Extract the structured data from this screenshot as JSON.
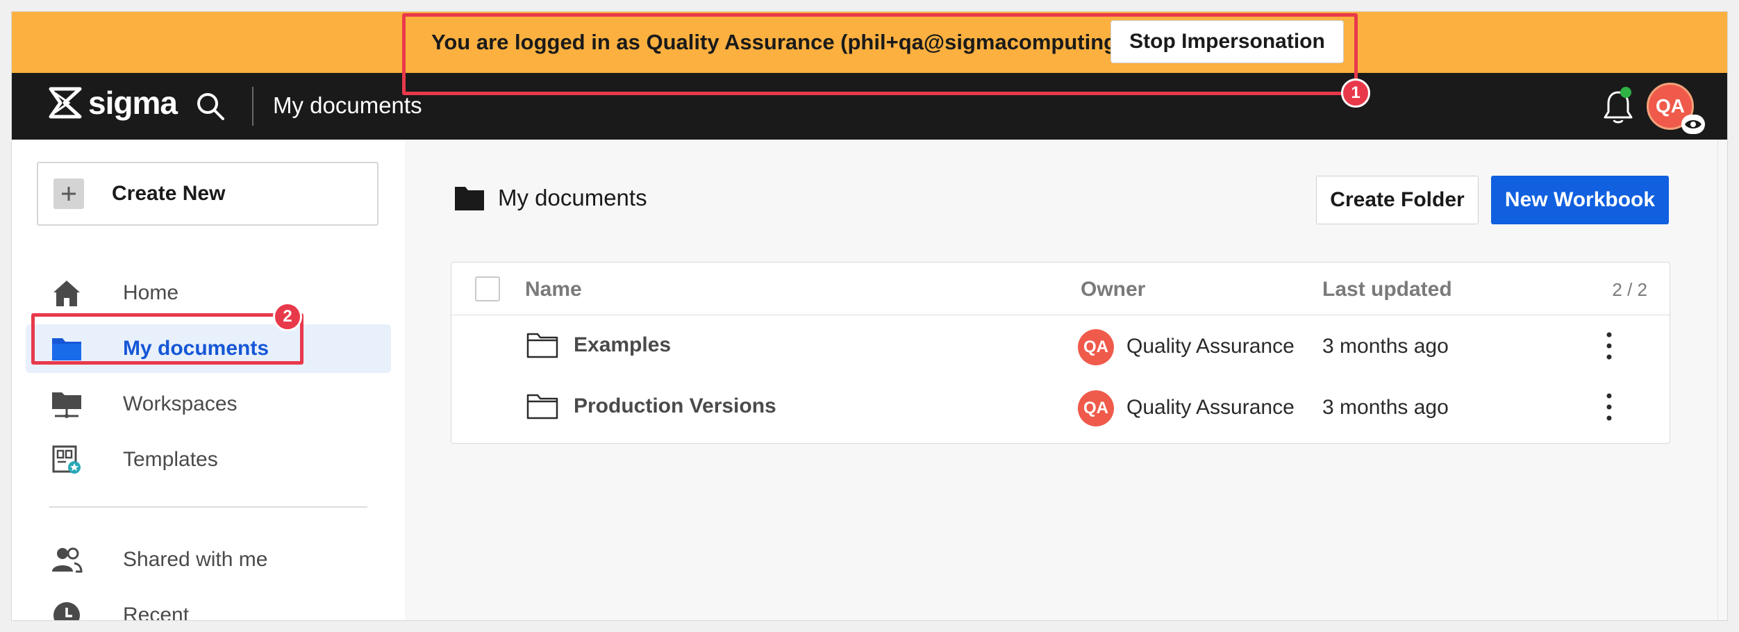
{
  "banner": {
    "message": "You are logged in as Quality Assurance (phil+qa@sigmacomputing.com)",
    "stop_label": "Stop Impersonation"
  },
  "topnav": {
    "logo_text": "sigma",
    "title": "My documents",
    "avatar_initials": "QA"
  },
  "sidebar": {
    "create_new_label": "Create New",
    "items": [
      {
        "label": "Home",
        "icon": "home-icon"
      },
      {
        "label": "My documents",
        "icon": "folder-icon",
        "active": true
      },
      {
        "label": "Workspaces",
        "icon": "workspaces-icon"
      },
      {
        "label": "Templates",
        "icon": "templates-icon"
      },
      {
        "label": "Shared with me",
        "icon": "shared-users-icon"
      },
      {
        "label": "Recent",
        "icon": "clock-icon"
      }
    ]
  },
  "main": {
    "title": "My documents",
    "create_folder_label": "Create Folder",
    "new_workbook_label": "New Workbook",
    "table": {
      "columns": [
        "Name",
        "Owner",
        "Last updated"
      ],
      "count": "2 / 2",
      "rows": [
        {
          "name": "Examples",
          "owner_initials": "QA",
          "owner": "Quality Assurance",
          "updated": "3 months ago"
        },
        {
          "name": "Production Versions",
          "owner_initials": "QA",
          "owner": "Quality Assurance",
          "updated": "3 months ago"
        }
      ]
    }
  },
  "callouts": [
    "1",
    "2"
  ],
  "colors": {
    "banner": "#fbb040",
    "nav": "#1a1a1a",
    "accent": "#1060e0",
    "callout": "#e8394b",
    "avatar": "#ef5a4b"
  }
}
